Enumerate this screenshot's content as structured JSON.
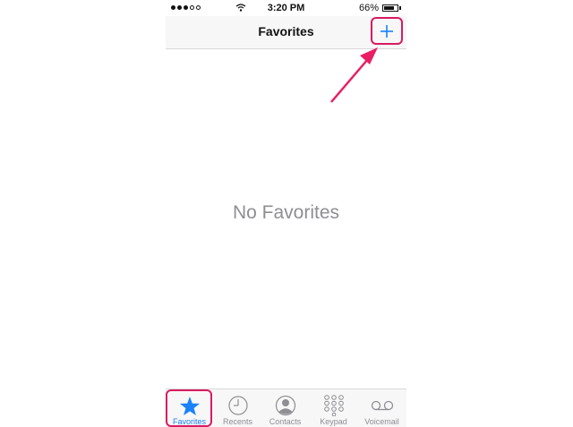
{
  "status_bar": {
    "time": "3:20 PM",
    "battery": "66%",
    "battery_level": 0.66,
    "signal_bars_filled": 3,
    "signal_bars_total": 5
  },
  "nav": {
    "title": "Favorites",
    "add_icon": "plus-icon"
  },
  "content": {
    "empty_message": "No Favorites"
  },
  "tab_bar": {
    "selected": "Favorites",
    "items": [
      {
        "label": "Favorites",
        "icon": "star-icon"
      },
      {
        "label": "Recents",
        "icon": "clock-icon"
      },
      {
        "label": "Contacts",
        "icon": "person-icon"
      },
      {
        "label": "Keypad",
        "icon": "keypad-icon"
      },
      {
        "label": "Voicemail",
        "icon": "voicemail-icon"
      }
    ]
  },
  "colors": {
    "accent": "#1a82fb",
    "highlight": "#d81b60",
    "inactive": "#8e8e93"
  }
}
